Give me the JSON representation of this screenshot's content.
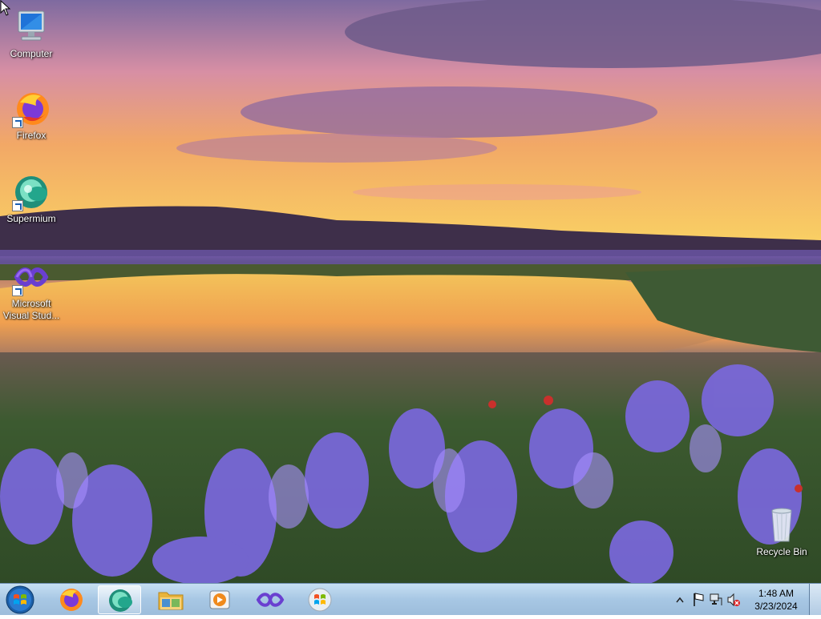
{
  "desktop": {
    "icons": [
      {
        "label": "Computer",
        "icon": "computer-icon"
      },
      {
        "label": "Firefox",
        "icon": "firefox-icon"
      },
      {
        "label": "Supermium",
        "icon": "supermium-icon"
      },
      {
        "label": "Microsoft Visual Stud...",
        "icon": "visual-studio-icon"
      },
      {
        "label": "Recycle Bin",
        "icon": "recycle-bin-icon"
      }
    ],
    "wallpaper": "sunset lake with purple flowers"
  },
  "taskbar": {
    "start": "start-orb-icon",
    "pinned": [
      {
        "name": "Firefox",
        "icon": "firefox-icon"
      },
      {
        "name": "Supermium",
        "icon": "supermium-icon",
        "active": true
      },
      {
        "name": "File Explorer",
        "icon": "folder-icon"
      },
      {
        "name": "Media Player",
        "icon": "media-player-icon"
      },
      {
        "name": "Visual Studio",
        "icon": "visual-studio-icon"
      },
      {
        "name": "Windows",
        "icon": "windows-logo-icon"
      }
    ],
    "tray": {
      "time": "1:48 AM",
      "date": "3/23/2024"
    }
  },
  "colors": {
    "taskbar": "#a7c7e4",
    "sky": "#f6b15a",
    "flowers": "#6a55d6"
  }
}
